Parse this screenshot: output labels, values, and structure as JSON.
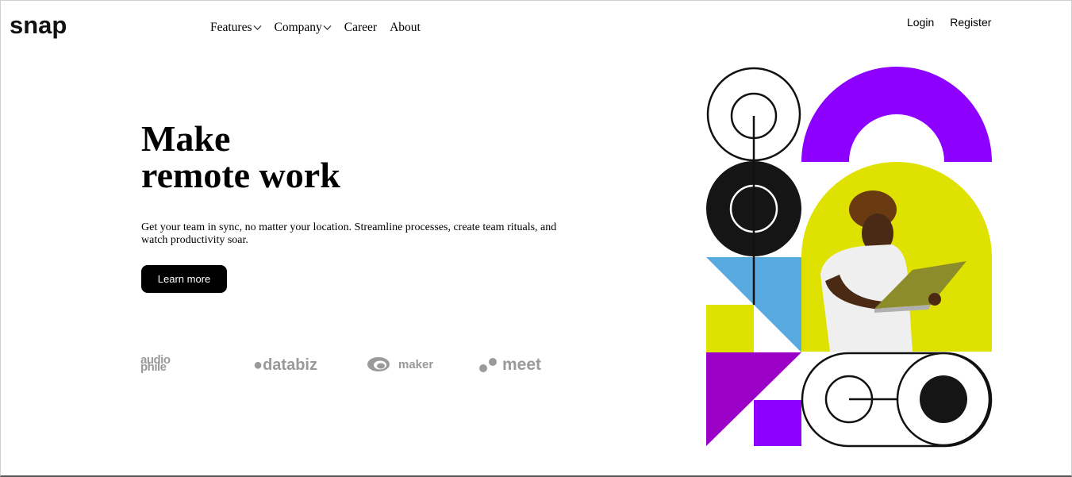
{
  "brand": {
    "logo": "snap"
  },
  "nav": {
    "items": [
      {
        "label": "Features",
        "dropdown": true
      },
      {
        "label": "Company",
        "dropdown": true
      },
      {
        "label": "Career",
        "dropdown": false
      },
      {
        "label": "About",
        "dropdown": false
      }
    ]
  },
  "auth": {
    "login": "Login",
    "register": "Register"
  },
  "hero": {
    "title_line1": "Make",
    "title_line2": "remote work",
    "description": "Get your team in sync, no matter your location. Streamline processes, create team rituals, and watch productivity soar.",
    "cta": "Learn more"
  },
  "clients": {
    "audiophile_line1": "audio",
    "audiophile_line2": "phile",
    "databiz": "databiz",
    "maker": "maker",
    "meet": "meet"
  },
  "colors": {
    "purple": "#8d00ff",
    "yellow": "#dfe200",
    "blue": "#58aae1",
    "dark": "#151515",
    "magenta": "#9b00c7",
    "logo_gray": "#9a9a9a"
  },
  "icons": {
    "dropdown": "chevron-down-icon"
  }
}
